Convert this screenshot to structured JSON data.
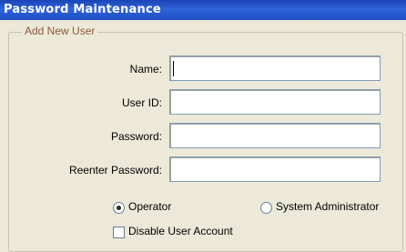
{
  "window": {
    "title": "Password Maintenance"
  },
  "group": {
    "label": "Add New User"
  },
  "form": {
    "name_label": "Name:",
    "userid_label": "User ID:",
    "password_label": "Password:",
    "reenter_label": "Reenter Password:",
    "name_value": "",
    "userid_value": "",
    "password_value": "",
    "reenter_value": ""
  },
  "role": {
    "operator_label": "Operator",
    "sysadmin_label": "System Administrator",
    "selected": "Operator"
  },
  "disable": {
    "label": "Disable User Account",
    "checked": false
  }
}
